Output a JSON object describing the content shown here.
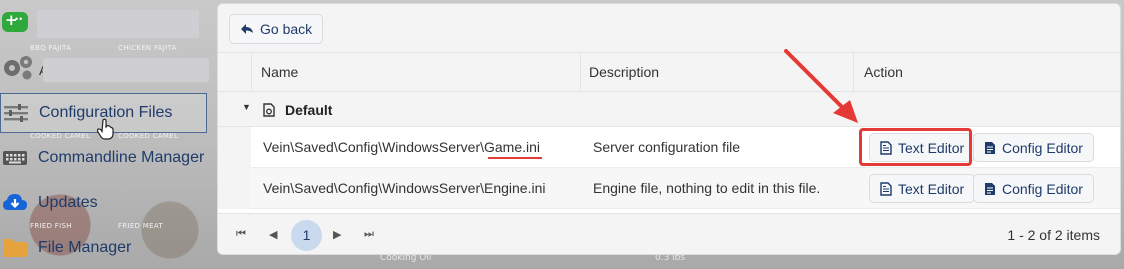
{
  "background": {
    "labels": [
      "BBQ FAJITA",
      "CHICKEN FAJITA",
      "COOKED CAMEL",
      "COOKED CAMEL",
      "FRIED FISH",
      "FRIED MEAT"
    ],
    "bottom_text": "Cooking Oil",
    "bottom_right_text": "0.3 lbs"
  },
  "sidebar": {
    "top_partial_label": "A",
    "items": [
      {
        "label": "Configuration Files",
        "icon": "sliders-icon"
      },
      {
        "label": "Commandline Manager",
        "icon": "keyboard-icon"
      },
      {
        "label": "Updates",
        "icon": "cloud-download-icon"
      },
      {
        "label": "File Manager",
        "icon": "folder-icon"
      }
    ]
  },
  "toolbar": {
    "back_label": "Go back"
  },
  "table": {
    "columns": [
      "Name",
      "Description",
      "Action"
    ],
    "group": "Default",
    "rows": [
      {
        "name": "Vein\\Saved\\Config\\WindowsServer\\Game.ini",
        "description": "Server configuration file",
        "actions": [
          "Text Editor",
          "Config Editor"
        ]
      },
      {
        "name": "Vein\\Saved\\Config\\WindowsServer\\Engine.ini",
        "description": "Engine file, nothing to edit in this file.",
        "actions": [
          "Text Editor",
          "Config Editor"
        ]
      }
    ]
  },
  "pager": {
    "current_page": "1",
    "info": "1 - 2 of 2 items"
  },
  "colors": {
    "accent": "#1f3b6a",
    "annotation": "#e53935",
    "page_active": "#c9d9ee"
  }
}
